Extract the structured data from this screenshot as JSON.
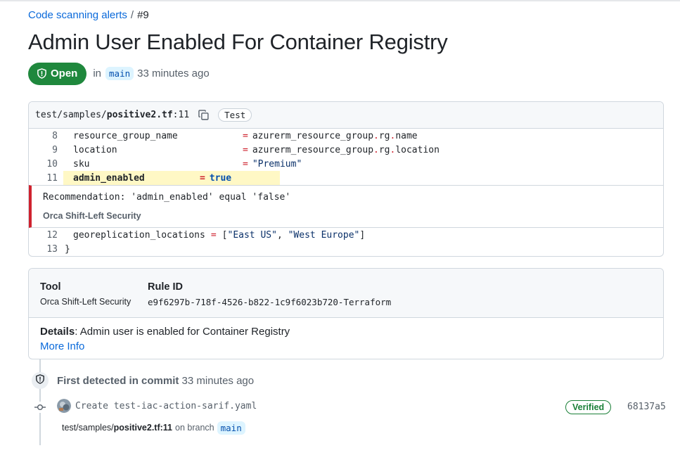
{
  "breadcrumb": {
    "link": "Code scanning alerts",
    "separator": "/",
    "number": "#9"
  },
  "page_title": "Admin User Enabled For Container Registry",
  "status": {
    "label": "Open",
    "in_text": "in",
    "branch": "main",
    "time": "33 minutes ago",
    "color": "#1f883d"
  },
  "code": {
    "path_prefix": "test/samples/",
    "file_name": "positive2.tf",
    "line_suffix": ":11",
    "copy_icon": "copy-icon",
    "tag": "Test",
    "lines_before": [
      {
        "num": "8",
        "key": "resource_group_name",
        "eq": "=",
        "value": "azurerm_resource_group.rg.name"
      },
      {
        "num": "9",
        "key": "location",
        "eq": "=",
        "value": "azurerm_resource_group.rg.location"
      },
      {
        "num": "10",
        "key": "sku",
        "eq": "=",
        "value": "\"Premium\""
      }
    ],
    "highlight": {
      "num": "11",
      "key": "admin_enabled",
      "eq": "=",
      "value": "true"
    },
    "recommendation": "Recommendation: 'admin_enabled' equal 'false'",
    "recommendation_tool": "Orca Shift-Left Security",
    "lines_after": [
      {
        "num": "12",
        "text": "georeplication_locations = [\"East US\", \"West Europe\"]"
      },
      {
        "num": "13",
        "text": "}"
      }
    ]
  },
  "info": {
    "tool_label": "Tool",
    "tool_value": "Orca Shift-Left Security",
    "rule_label": "Rule ID",
    "rule_value": "e9f6297b-718f-4526-b822-1c9f6023b720-Terraform",
    "details_label": "Details",
    "details_text": ": Admin user is enabled for Container Registry",
    "more_info": "More Info"
  },
  "timeline": {
    "first_detected_label": "First detected in commit",
    "first_detected_time": "33 minutes ago",
    "shield_icon": "shield-icon",
    "commit_message": "Create test-iac-action-sarif.yaml",
    "verified": "Verified",
    "sha": "68137a5",
    "branch_path_prefix": "test/samples/",
    "branch_path_file": "positive2.tf:11",
    "on_branch": "on branch",
    "branch": "main"
  },
  "colors": {
    "link": "#0969da",
    "danger": "#cf222e",
    "success": "#1a7f37",
    "highlight": "#fff8c5"
  }
}
